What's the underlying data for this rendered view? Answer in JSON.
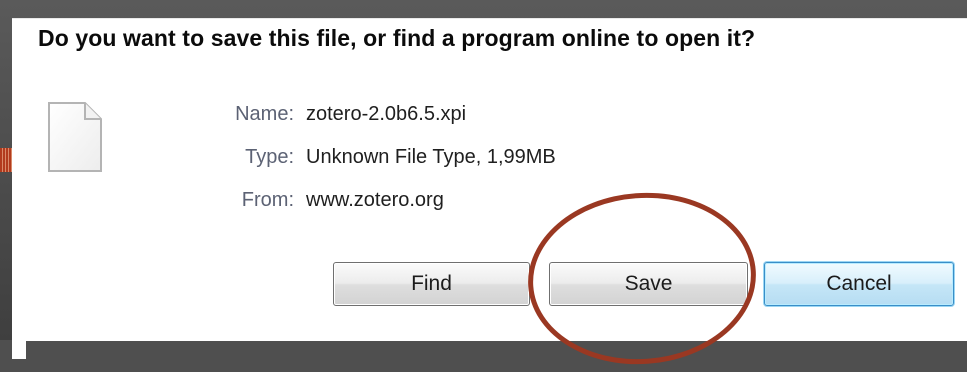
{
  "dialog": {
    "question": "Do you want to save this file, or find a program online to open it?",
    "file_icon": "generic-file-icon",
    "fields": [
      {
        "label": "Name:",
        "value": "zotero-2.0b6.5.xpi"
      },
      {
        "label": "Type:",
        "value": "Unknown File Type, 1,99MB"
      },
      {
        "label": "From:",
        "value": "www.zotero.org"
      }
    ],
    "buttons": {
      "find": "Find",
      "save": "Save",
      "cancel": "Cancel"
    }
  },
  "colors": {
    "background": "#4f4f4f",
    "dialog": "#ffffff",
    "highlight_circle": "#9a3822",
    "default_button_border": "#3a8ec8"
  }
}
